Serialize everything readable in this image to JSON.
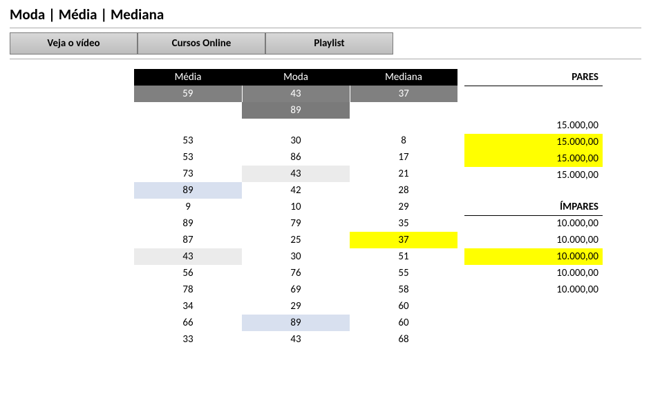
{
  "title": "Moda | Média | Mediana",
  "buttons": [
    "Veja o vídeo",
    "Cursos Online",
    "Playlist"
  ],
  "stats": {
    "headers": [
      "Média",
      "Moda",
      "Mediana"
    ],
    "results": [
      "59",
      "43",
      "37"
    ],
    "extra_moda": "89",
    "rows": [
      {
        "a": "53",
        "b": "30",
        "c": "8",
        "hl": {}
      },
      {
        "a": "53",
        "b": "86",
        "c": "17",
        "hl": {}
      },
      {
        "a": "73",
        "b": "43",
        "c": "21",
        "hl": {
          "b": "gray"
        }
      },
      {
        "a": "89",
        "b": "42",
        "c": "28",
        "hl": {
          "a": "blue"
        }
      },
      {
        "a": "9",
        "b": "10",
        "c": "29",
        "hl": {}
      },
      {
        "a": "89",
        "b": "79",
        "c": "35",
        "hl": {}
      },
      {
        "a": "87",
        "b": "25",
        "c": "37",
        "hl": {
          "c": "yellow"
        }
      },
      {
        "a": "43",
        "b": "30",
        "c": "51",
        "hl": {
          "a": "gray"
        }
      },
      {
        "a": "56",
        "b": "76",
        "c": "55",
        "hl": {}
      },
      {
        "a": "78",
        "b": "69",
        "c": "58",
        "hl": {}
      },
      {
        "a": "34",
        "b": "29",
        "c": "60",
        "hl": {}
      },
      {
        "a": "66",
        "b": "89",
        "c": "60",
        "hl": {
          "b": "blue"
        }
      },
      {
        "a": "33",
        "b": "43",
        "c": "68",
        "hl": {}
      }
    ]
  },
  "right": {
    "pares_label": "PARES",
    "pares": [
      {
        "v": "15.000,00",
        "y": false
      },
      {
        "v": "15.000,00",
        "y": true
      },
      {
        "v": "15.000,00",
        "y": true
      },
      {
        "v": "15.000,00",
        "y": false
      }
    ],
    "impares_label": "ÍMPARES",
    "impares": [
      {
        "v": "10.000,00",
        "y": false
      },
      {
        "v": "10.000,00",
        "y": false
      },
      {
        "v": "10.000,00",
        "y": true
      },
      {
        "v": "10.000,00",
        "y": false
      },
      {
        "v": "10.000,00",
        "y": false
      }
    ]
  }
}
